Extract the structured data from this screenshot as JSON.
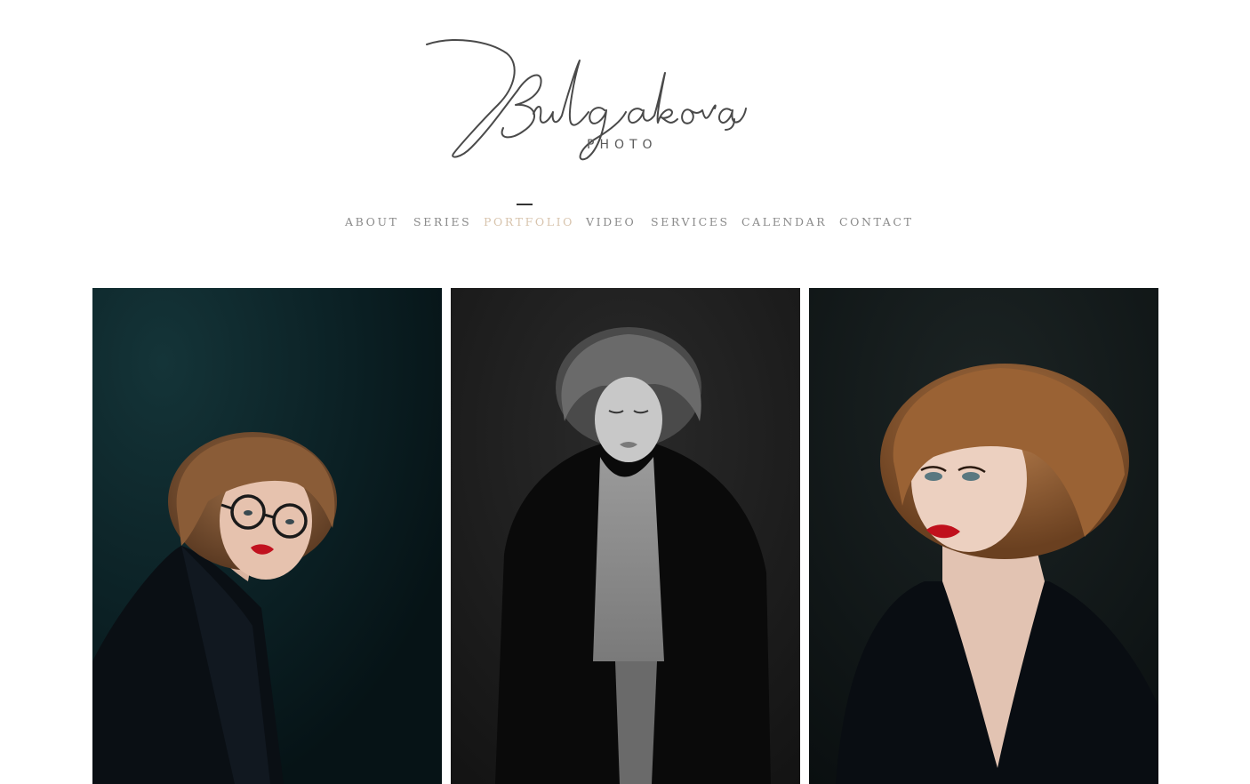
{
  "brand": {
    "script_name": "Bulgakova",
    "subtitle": "PHOTO"
  },
  "nav": {
    "items": [
      {
        "label": "ABOUT",
        "active": false
      },
      {
        "label": "SERIES",
        "active": false
      },
      {
        "label": "PORTFOLIO",
        "active": true
      },
      {
        "label": "VIDEO",
        "active": false
      },
      {
        "label": "SERVICES",
        "active": false
      },
      {
        "label": "CALENDAR",
        "active": false
      },
      {
        "label": "CONTACT",
        "active": false
      }
    ]
  },
  "colors": {
    "nav_text": "#8a8a8a",
    "nav_active": "#d8c4ad",
    "logo_ink": "#4a4a4a",
    "background": "#ffffff"
  },
  "gallery": {
    "photos": [
      {
        "icon": "portrait-photo-teal-glasses"
      },
      {
        "icon": "portrait-photo-black-white"
      },
      {
        "icon": "portrait-photo-dark-closeup"
      }
    ]
  }
}
